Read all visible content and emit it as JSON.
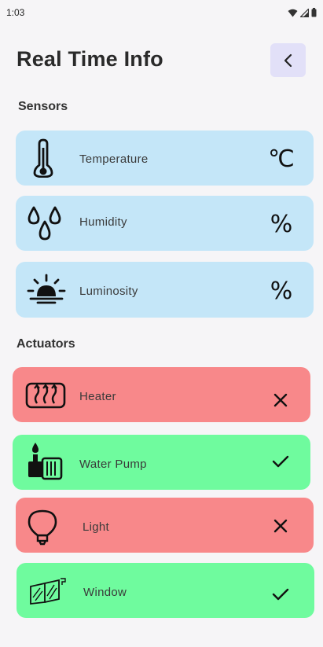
{
  "status_bar": {
    "time": "1:03",
    "icons": [
      "wifi-icon",
      "signal-icon",
      "battery-icon"
    ]
  },
  "header": {
    "title": "Real Time Info",
    "back_icon": "chevron-left-icon"
  },
  "sensors": {
    "section_title": "Sensors",
    "items": [
      {
        "label": "Temperature",
        "icon": "thermometer-icon",
        "value": "℃"
      },
      {
        "label": "Humidity",
        "icon": "droplets-icon",
        "value": "%"
      },
      {
        "label": "Luminosity",
        "icon": "sunrise-icon",
        "value": "%"
      }
    ]
  },
  "actuators": {
    "section_title": "Actuators",
    "items": [
      {
        "label": "Heater",
        "icon": "heater-icon",
        "state": "off",
        "state_icon": "x-icon",
        "color": "#f8888a"
      },
      {
        "label": "Water Pump",
        "icon": "water-pump-icon",
        "state": "on",
        "state_icon": "check-icon",
        "color": "#6ffb9e"
      },
      {
        "label": "Light",
        "icon": "lightbulb-icon",
        "state": "off",
        "state_icon": "x-icon",
        "color": "#f8888a"
      },
      {
        "label": "Window",
        "icon": "window-icon",
        "state": "on",
        "state_icon": "check-icon",
        "color": "#6ffb9e"
      }
    ]
  },
  "colors": {
    "background": "#f6f5f7",
    "sensor_card": "#c4e6f8",
    "actuator_off": "#f8888a",
    "actuator_on": "#6ffb9e",
    "back_button": "#e2e0f8"
  }
}
